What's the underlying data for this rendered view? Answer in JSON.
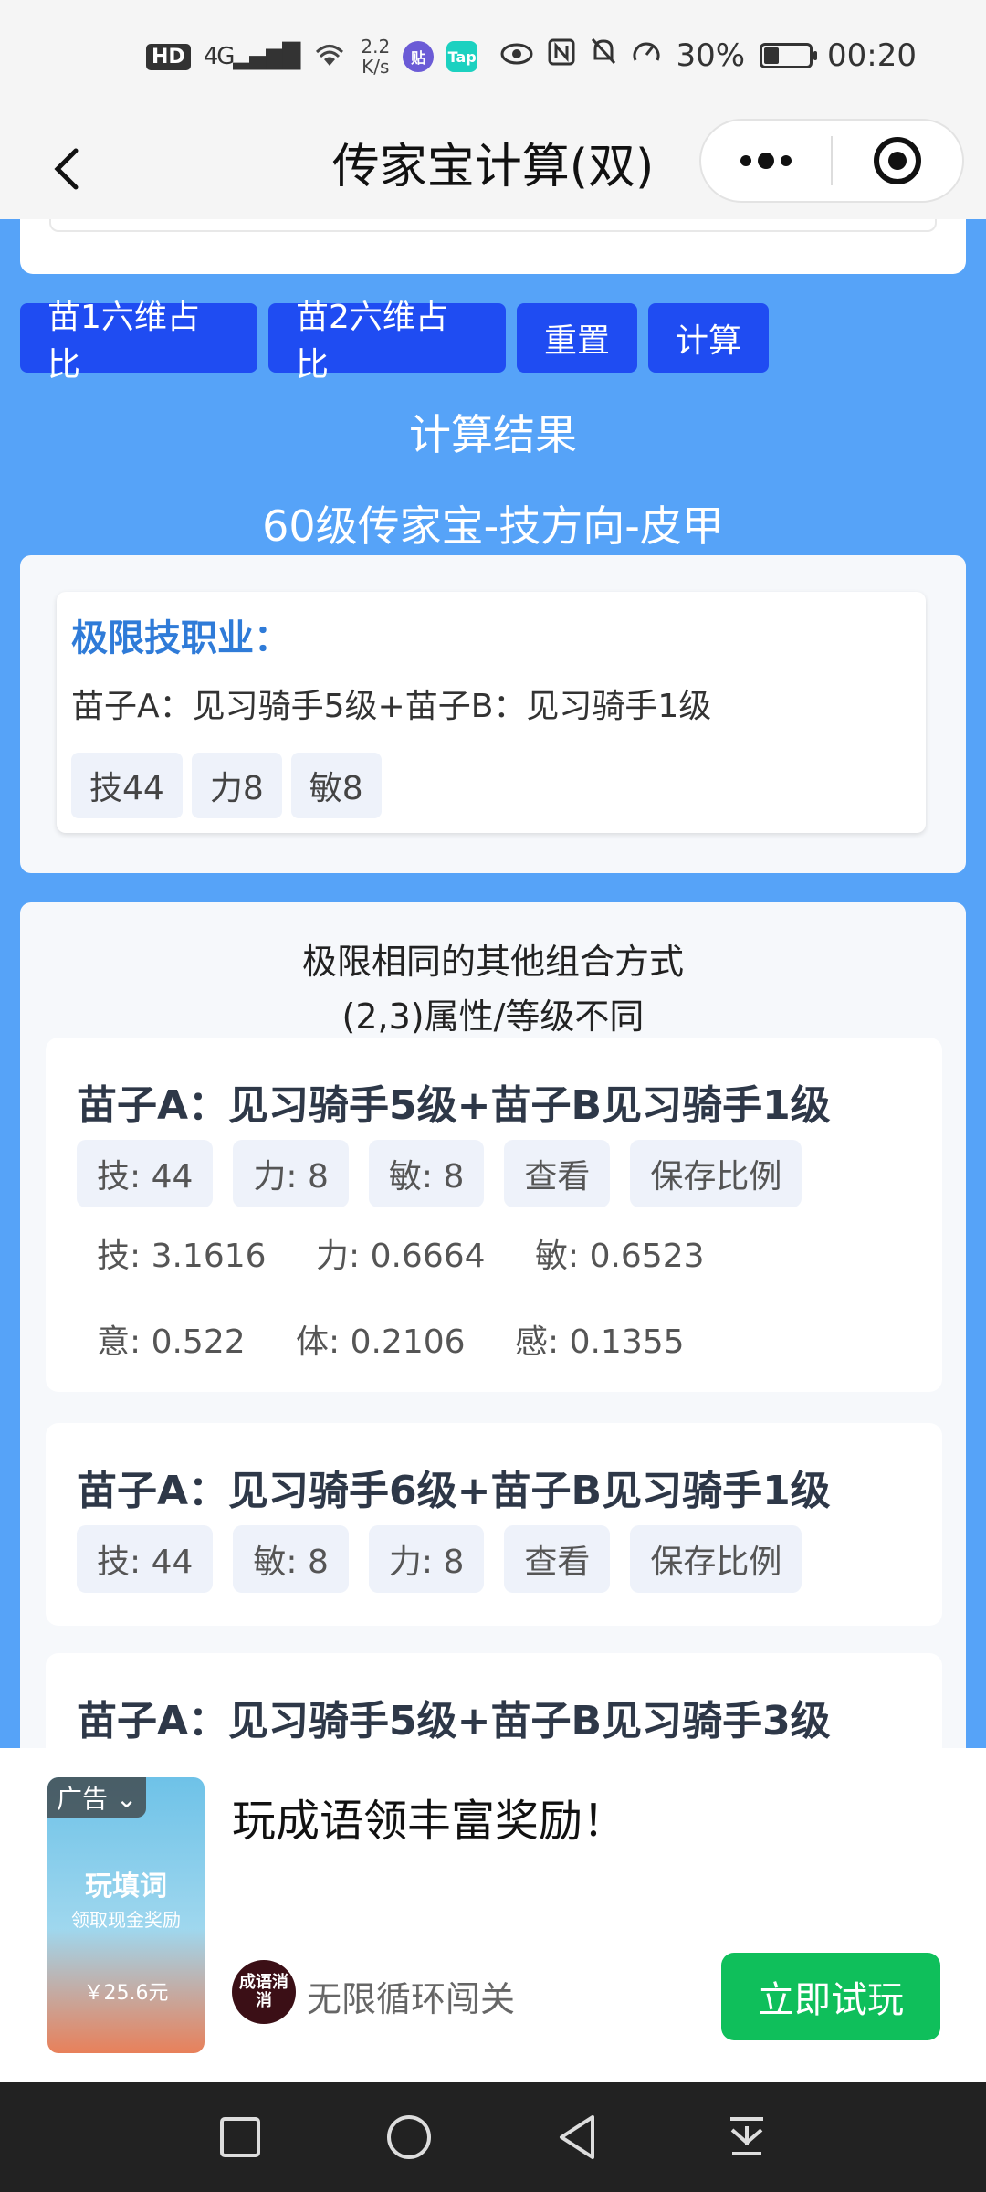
{
  "status_bar": {
    "hd": "HD",
    "network": "4G",
    "speed_value": "2.2",
    "speed_unit": "K/s",
    "app1_icon": "贴",
    "app2_icon": "Tap",
    "battery": "30%",
    "battery_level": 0.3,
    "time": "00:20"
  },
  "nav": {
    "title": "传家宝计算(双)"
  },
  "toolbar": {
    "btn1": "苗1六维占比",
    "btn2": "苗2六维占比",
    "btn3": "重置",
    "btn4": "计算"
  },
  "result": {
    "title": "计算结果",
    "subtitle": "60级传家宝-技方向-皮甲"
  },
  "limit": {
    "heading": "极限技职业：",
    "desc": "苗子A：见习骑手5级+苗子B：见习骑手1级",
    "tags": [
      "技44",
      "力8",
      "敏8"
    ]
  },
  "others": {
    "title1": "极限相同的其他组合方式",
    "title2": "(2,3)属性/等级不同",
    "combos": [
      {
        "title": "苗子A：见习骑手5级+苗子B见习骑手1级",
        "tags": [
          "技: 44",
          "力: 8",
          "敏: 8"
        ],
        "view": "查看",
        "save": "保存比例",
        "ratios1": [
          "技: 3.1616",
          "力: 0.6664",
          "敏: 0.6523"
        ],
        "ratios2": [
          "意: 0.522",
          "体: 0.2106",
          "感: 0.1355"
        ]
      },
      {
        "title": "苗子A：见习骑手6级+苗子B见习骑手1级",
        "tags": [
          "技: 44",
          "敏: 8",
          "力: 8"
        ],
        "view": "查看",
        "save": "保存比例"
      },
      {
        "title": "苗子A：见习骑手5级+苗子B见习骑手3级"
      }
    ]
  },
  "ad": {
    "label": "广告",
    "thumb_title": "玩填词",
    "thumb_sub": "领取现金奖励",
    "thumb_amount": "￥25.6元",
    "title": "玩成语领丰富奖励！",
    "logo_text": "成语消消",
    "name": "无限循环闯关",
    "cta": "立即试玩"
  }
}
